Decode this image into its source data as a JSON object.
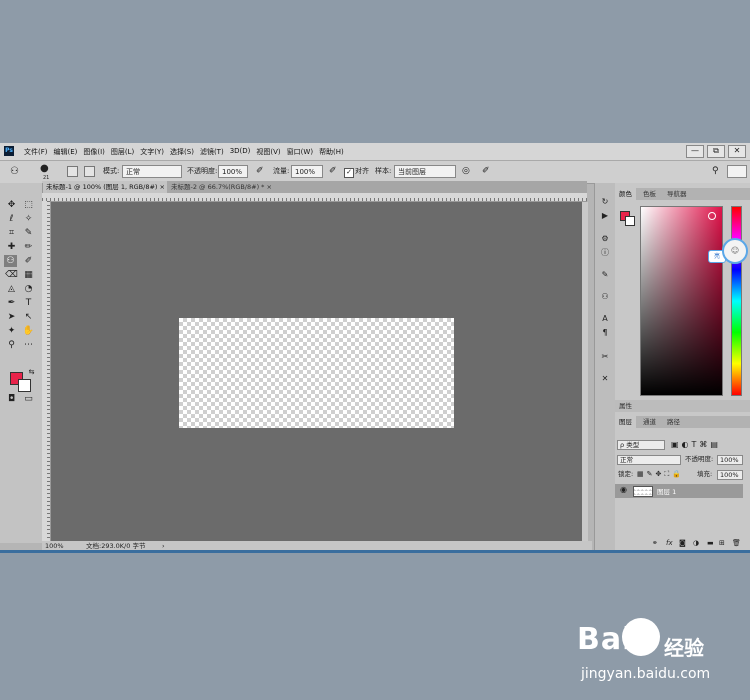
{
  "menubar": {
    "app_icon": "Ps",
    "items": [
      "文件(F)",
      "编辑(E)",
      "图像(I)",
      "图层(L)",
      "文字(Y)",
      "选择(S)",
      "滤镜(T)",
      "3D(D)",
      "视图(V)",
      "窗口(W)",
      "帮助(H)"
    ],
    "window_controls": [
      "—",
      "⧉",
      "✕"
    ]
  },
  "options": {
    "brush_size": "21",
    "mode_label": "模式:",
    "mode_value": "正常",
    "opacity_label": "不透明度:",
    "opacity_value": "100%",
    "flow_label": "流量:",
    "flow_value": "100%",
    "align_label": "对齐",
    "sample_label": "样本:",
    "sample_value": "当前图层"
  },
  "tabs": [
    {
      "label": "未标题-1 @ 100% (图层 1, RGB/8#) ×"
    },
    {
      "label": "未标题-2 @ 66.7%(RGB/8#) * ×"
    }
  ],
  "colors": {
    "foreground": "#e8234a",
    "background": "#ffffff"
  },
  "status": {
    "zoom": "100%",
    "doc": "文档:293.0K/0 字节",
    "arrow": "›"
  },
  "color_panel": {
    "tabs": [
      "颜色",
      "色板",
      "导航器"
    ],
    "floating_label": "亮"
  },
  "layers_panel": {
    "header": "属性",
    "tabs": [
      "图层",
      "通道",
      "路径"
    ],
    "kind_filter": "ρ 类型",
    "blend_mode": "正常",
    "opacity_label": "不透明度:",
    "opacity_value": "100%",
    "lock_label": "锁定:",
    "fill_label": "填充:",
    "fill_value": "100%",
    "layer_name": "图层 1",
    "footer_fx": "fx"
  },
  "watermark": {
    "brand": "Bai",
    "brand2": "经验",
    "url": "jingyan.baidu.com"
  }
}
